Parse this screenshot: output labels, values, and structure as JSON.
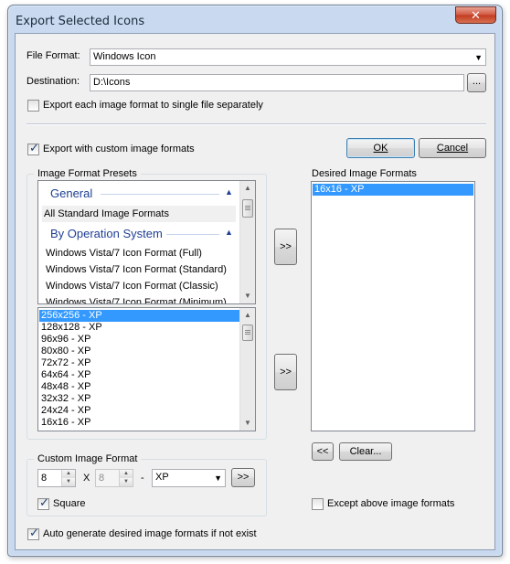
{
  "window": {
    "title": "Export Selected Icons",
    "close_glyph": "✕"
  },
  "file_format": {
    "label": "File Format:",
    "value": "Windows Icon"
  },
  "destination": {
    "label": "Destination:",
    "value": "D:\\Icons",
    "browse_label": "..."
  },
  "export_separately": {
    "label": "Export each image format to single file separately",
    "checked": false
  },
  "export_custom": {
    "label": "Export with custom image formats",
    "checked": true
  },
  "buttons": {
    "ok": "OK",
    "cancel": "Cancel",
    "add_preset": ">>",
    "add_size": ">>",
    "remove": "<<",
    "clear": "Clear...",
    "add_custom": ">>"
  },
  "presets": {
    "title": "Image Format Presets",
    "groups": [
      {
        "header": "General",
        "items": [
          "All Standard Image Formats"
        ]
      },
      {
        "header": "By Operation System",
        "items": [
          "Windows Vista/7 Icon Format (Full)",
          "Windows Vista/7 Icon Format (Standard)",
          "Windows Vista/7 Icon Format (Classic)",
          "Windows Vista/7 Icon Format (Minimum)"
        ]
      }
    ]
  },
  "sizes": {
    "items": [
      "256x256 - XP",
      "128x128 - XP",
      "96x96 - XP",
      "80x80 - XP",
      "72x72 - XP",
      "64x64 - XP",
      "48x48 - XP",
      "32x32 - XP",
      "24x24 - XP",
      "16x16 - XP"
    ],
    "selected_index": 0
  },
  "desired": {
    "title": "Desired Image Formats",
    "items": [
      "16x16 - XP"
    ],
    "selected_index": 0
  },
  "custom_format": {
    "title": "Custom Image Format",
    "width": "8",
    "separator": "X",
    "height": "8",
    "dash": "-",
    "color_mode": "XP",
    "square_label": "Square",
    "square_checked": true
  },
  "except_above": {
    "label": "Except above image formats",
    "checked": false
  },
  "auto_generate": {
    "label": "Auto generate desired image formats if not exist",
    "checked": true
  },
  "colors": {
    "selection": "#3399ff",
    "group_header": "#1e3f93",
    "frame": "#c9daf0"
  }
}
